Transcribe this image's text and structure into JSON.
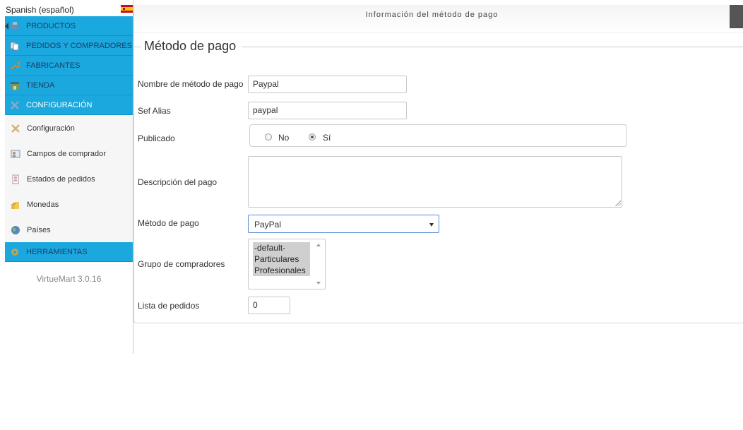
{
  "language": {
    "label": "Spanish (español)",
    "flag_icon": "spain-flag-icon"
  },
  "menu": [
    {
      "label": "PRODUCTOS",
      "icon": "products-icon"
    },
    {
      "label": "PEDIDOS Y COMPRADORES",
      "icon": "orders-icon"
    },
    {
      "label": "FABRICANTES",
      "icon": "wrench-icon"
    },
    {
      "label": "TIENDA",
      "icon": "store-icon"
    },
    {
      "label": "CONFIGURACIÓN",
      "icon": "config-icon",
      "active": true
    },
    {
      "label": "HERRAMIENTAS",
      "icon": "tools-icon"
    }
  ],
  "submenu": [
    {
      "label": "Configuración",
      "icon": "configuration-icon"
    },
    {
      "label": "Campos de comprador",
      "icon": "shopper-fields-icon"
    },
    {
      "label": "Estados de pedidos",
      "icon": "order-status-icon"
    },
    {
      "label": "Monedas",
      "icon": "currencies-icon"
    },
    {
      "label": "Países",
      "icon": "globe-icon"
    }
  ],
  "version": "VirtueMart 3.0.16",
  "header": {
    "title": "Información del método de pago"
  },
  "form": {
    "legend": "Método de pago",
    "name": {
      "label": "Nombre de método de pago",
      "value": "Paypal"
    },
    "sef_alias": {
      "label": "Sef Alias",
      "value": "paypal"
    },
    "published": {
      "label": "Publicado",
      "options": [
        "No",
        "Sí"
      ],
      "selected": "Sí"
    },
    "description": {
      "label": "Descripción del pago",
      "value": ""
    },
    "payment_method": {
      "label": "Método de pago",
      "value": "PayPal"
    },
    "shopper_group": {
      "label": "Grupo de compradores",
      "options": [
        "-default-",
        "Particulares",
        "Profesionales"
      ]
    },
    "order_list": {
      "label": "Lista de pedidos",
      "value": "0"
    }
  },
  "colors": {
    "menu_bg": "#1aa8de",
    "menu_text": "#1c3f66",
    "active_text": "#ffffff",
    "select_border": "#5b8cd9"
  }
}
